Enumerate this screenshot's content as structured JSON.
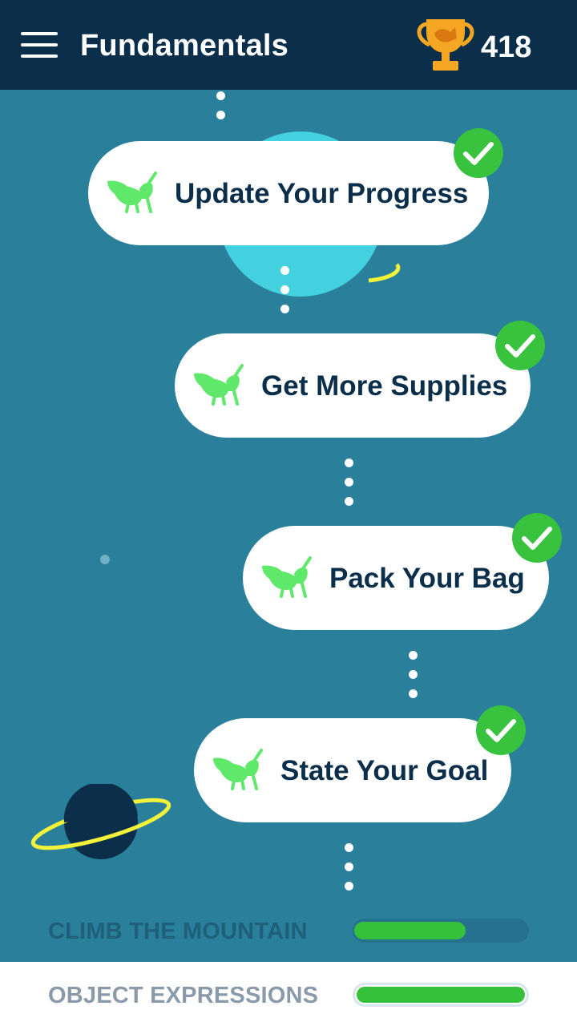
{
  "header": {
    "title": "Fundamentals",
    "score": "418"
  },
  "lessons": [
    {
      "label": "Update Your Progress",
      "completed": true
    },
    {
      "label": "Get More Supplies",
      "completed": true
    },
    {
      "label": "Pack Your Bag",
      "completed": true
    },
    {
      "label": "State Your Goal",
      "completed": true
    }
  ],
  "courses": [
    {
      "label": "CLIMB THE MOUNTAIN",
      "progress": 0.65
    },
    {
      "label": "OBJECT EXPRESSIONS",
      "progress": 1.0
    }
  ],
  "colors": {
    "background": "#2a7f9b",
    "header": "#0b2f4a",
    "accent_green": "#38c23e",
    "bug_green": "#5fe86a",
    "planet_cyan": "#43d1df",
    "ring_yellow": "#f2f23a",
    "trophy_gold": "#f5a623"
  }
}
